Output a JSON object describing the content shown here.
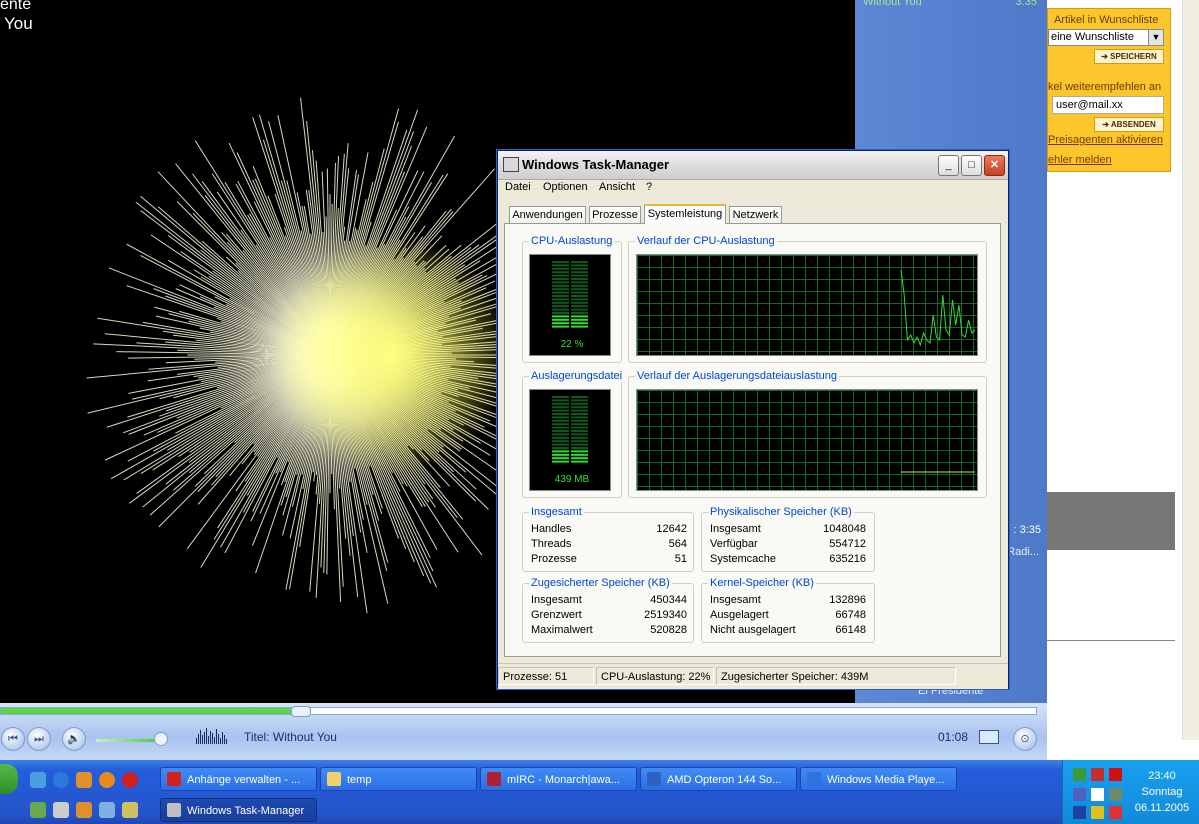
{
  "now_playing": {
    "artist_partial": "ente",
    "title_partial": "You"
  },
  "wmp_playlist": {
    "track": "Without You",
    "track_time": "3:35",
    "total_time": ": 3:35",
    "radio_partial": "Radi...",
    "artist": "El Presidente"
  },
  "web": {
    "wishlist_title": "Artikel in Wunschliste",
    "wishlist_select": "eine Wunschliste",
    "save_button": "SPEICHERN",
    "recommend_label": "kel weiterempfehlen an",
    "email_value": "user@mail.xx",
    "send_button": "ABSENDEN",
    "price_agent_link": "Preisagenten aktivieren",
    "report_error_link": "ehler melden"
  },
  "player_bar": {
    "title_label": "Titel: Without You",
    "elapsed": "01:08",
    "seek_fraction": 0.28,
    "volume_fraction": 0.9
  },
  "taskbar": {
    "row1": [
      {
        "label": "Anhänge verwalten - ...",
        "icon": "opera-icon",
        "color": "#d02020"
      },
      {
        "label": "temp",
        "icon": "folder-icon",
        "color": "#f2d06b"
      },
      {
        "label": "mIRC - Monarch|awa...",
        "icon": "mirc-icon",
        "color": "#b02030"
      },
      {
        "label": "AMD Opteron 144 So...",
        "icon": "browser-icon",
        "color": "#3060c0"
      },
      {
        "label": "Windows Media Playe...",
        "icon": "media-player-icon",
        "color": "#3070e0"
      }
    ],
    "row2": [
      {
        "label": "Windows Task-Manager",
        "icon": "task-manager-icon",
        "color": "#c0c0c0"
      }
    ],
    "clock": {
      "time": "23:40",
      "day": "Sonntag",
      "date": "06.11.2005"
    }
  },
  "task_manager": {
    "title": "Windows Task-Manager",
    "menu": [
      "Datei",
      "Optionen",
      "Ansicht",
      "?"
    ],
    "tabs": [
      "Anwendungen",
      "Prozesse",
      "Systemleistung",
      "Netzwerk"
    ],
    "selected_tab": "Systemleistung",
    "cpu": {
      "label": "CPU-Auslastung",
      "value": "22 %",
      "fraction": 0.22
    },
    "cpu_history": {
      "label": "Verlauf der CPU-Auslastung"
    },
    "pagefile": {
      "label": "Auslagerungsdatei",
      "value": "439 MB",
      "fraction": 0.22
    },
    "pagefile_history": {
      "label": "Verlauf der Auslagerungsdateiauslastung"
    },
    "totals": {
      "label": "Insgesamt",
      "rows": [
        {
          "k": "Handles",
          "v": "12642"
        },
        {
          "k": "Threads",
          "v": "564"
        },
        {
          "k": "Prozesse",
          "v": "51"
        }
      ]
    },
    "physical": {
      "label": "Physikalischer Speicher (KB)",
      "rows": [
        {
          "k": "Insgesamt",
          "v": "1048048"
        },
        {
          "k": "Verfügbar",
          "v": "554712"
        },
        {
          "k": "Systemcache",
          "v": "635216"
        }
      ]
    },
    "commit": {
      "label": "Zugesicherter Speicher (KB)",
      "rows": [
        {
          "k": "Insgesamt",
          "v": "450344"
        },
        {
          "k": "Grenzwert",
          "v": "2519340"
        },
        {
          "k": "Maximalwert",
          "v": "520828"
        }
      ]
    },
    "kernel": {
      "label": "Kernel-Speicher (KB)",
      "rows": [
        {
          "k": "Insgesamt",
          "v": "132896"
        },
        {
          "k": "Ausgelagert",
          "v": "66748"
        },
        {
          "k": "Nicht ausgelagert",
          "v": "66148"
        }
      ]
    },
    "status": {
      "processes": "Prozesse: 51",
      "cpu": "CPU-Auslastung: 22%",
      "commit": "Zugesicherter Speicher: 439M"
    }
  },
  "colors": {
    "wmp_blue": "#4d79c8",
    "graph_green": "#2fe02f",
    "taskbar_blue": "#245edb",
    "group_label_blue": "#0046d5",
    "web_accent": "#fbc72d"
  }
}
